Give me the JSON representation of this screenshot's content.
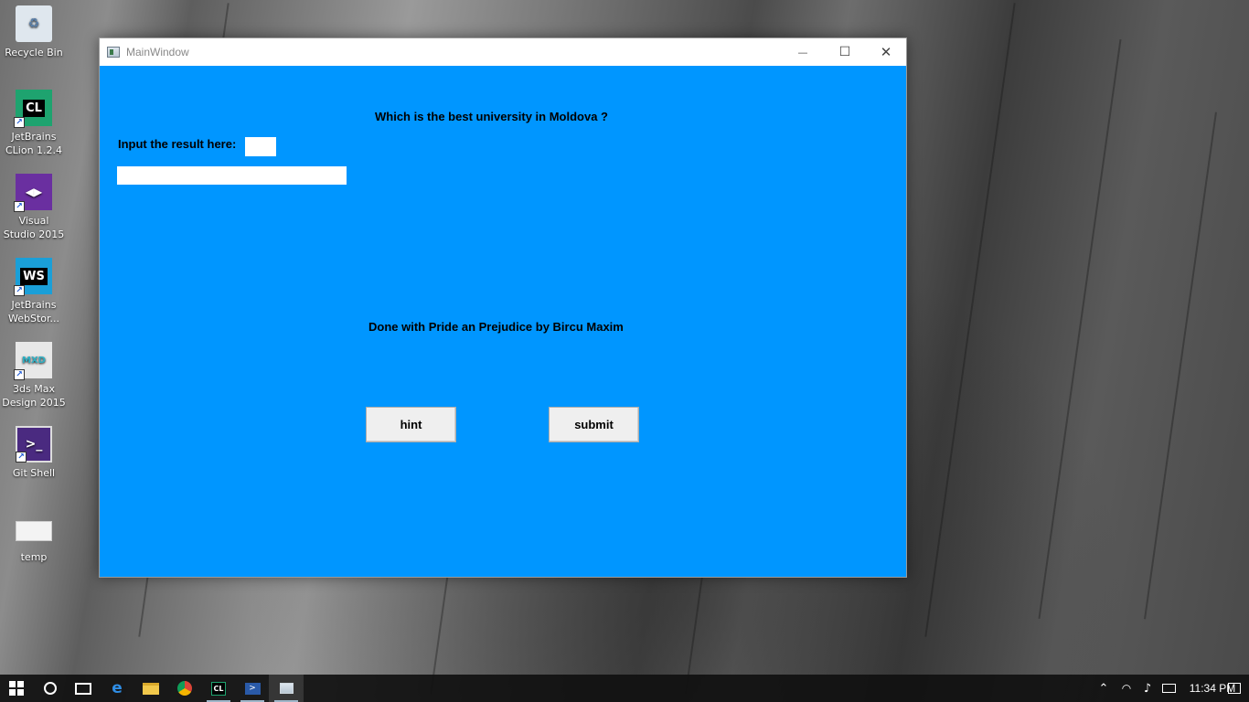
{
  "desktop": {
    "icons": [
      {
        "label": "Recycle Bin",
        "glyph": "♻",
        "color": "#5a7fa8"
      },
      {
        "label": "JetBrains CLion 1.2.4",
        "glyph": "CL",
        "color": "#1ea36f"
      },
      {
        "label": "Visual Studio 2015",
        "glyph": "◀▶",
        "color": "#6a2fa0"
      },
      {
        "label": "JetBrains WebStor...",
        "glyph": "WS",
        "color": "#1a9fd8"
      },
      {
        "label": "3ds Max Design 2015",
        "glyph": "MXD",
        "color": "#2fb0c4"
      },
      {
        "label": "Git Shell",
        "glyph": ">_",
        "color": "#4a2a80"
      },
      {
        "label": "temp",
        "glyph": "",
        "color": "#f3f3f3"
      }
    ]
  },
  "window": {
    "title": "MainWindow",
    "controls": {
      "minimize": "—",
      "maximize": "☐",
      "close": "✕"
    },
    "question": "Which is the best university in Moldova ?",
    "input_label": "Input the result here:",
    "small_input_value": "",
    "answer_input_value": "",
    "credit": "Done with Pride an Prejudice by Bircu Maxim",
    "hint_button": "hint",
    "submit_button": "submit"
  },
  "taskbar": {
    "clock": "11:34 PM",
    "colors": {
      "client_bg": "#0096ff",
      "taskbar_bg": "#101010"
    }
  }
}
